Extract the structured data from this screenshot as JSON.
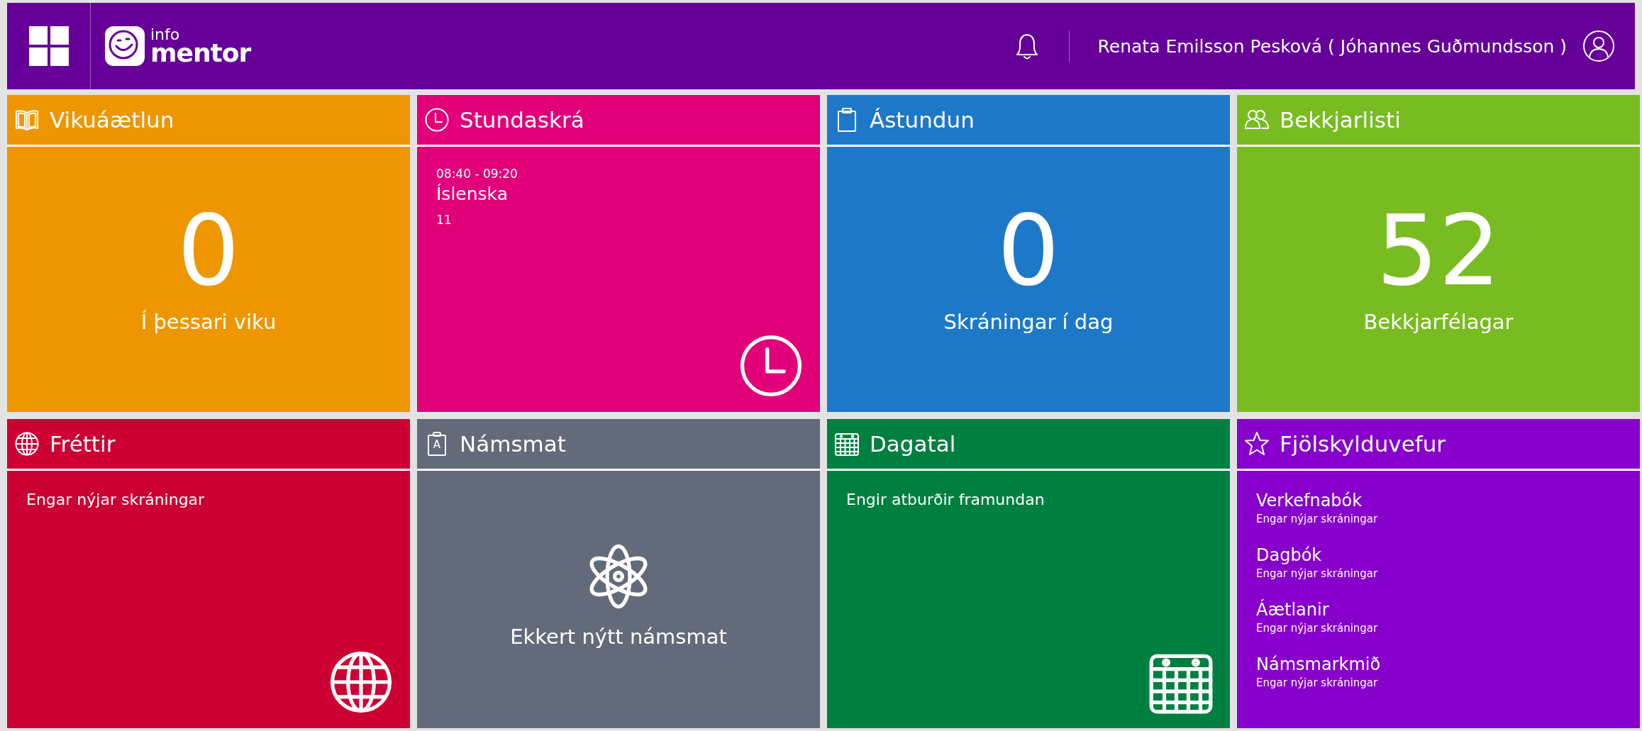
{
  "header": {
    "logo": {
      "small": "info",
      "large": "mentor"
    },
    "user": "Renata Emilsson Pesková ( Jóhannes Guðmundsson )"
  },
  "tiles": [
    {
      "kind": "week-plan",
      "color": "#ee9600",
      "title": "Vikuáætlun",
      "count": "0",
      "caption": "Í þessari viku"
    },
    {
      "kind": "timetable",
      "color": "#e2007a",
      "title": "Stundaskrá",
      "lesson": {
        "time": "08:40 - 09:20",
        "subject": "Íslenska",
        "room": "11"
      }
    },
    {
      "kind": "attendance",
      "color": "#1e78c8",
      "title": "Ástundun",
      "count": "0",
      "caption": "Skráningar í dag"
    },
    {
      "kind": "class-list",
      "color": "#79bc21",
      "title": "Bekkjarlisti",
      "count": "52",
      "caption": "Bekkjarfélagar"
    },
    {
      "kind": "news",
      "color": "#cc0033",
      "title": "Fréttir",
      "message": "Engar nýjar skráningar"
    },
    {
      "kind": "assessment",
      "color": "#636a7a",
      "title": "Námsmat",
      "icon_letter": "A",
      "caption": "Ekkert nýtt námsmat"
    },
    {
      "kind": "calendar",
      "color": "#008040",
      "title": "Dagatal",
      "message": "Engir atburðir framundan"
    },
    {
      "kind": "family",
      "color": "#8800cc",
      "title": "Fjölskylduvefur",
      "items": [
        {
          "title": "Verkefnabók",
          "status": "Engar nýjar skráningar"
        },
        {
          "title": "Dagbók",
          "status": "Engar nýjar skráningar"
        },
        {
          "title": "Áætlanir",
          "status": "Engar nýjar skráningar"
        },
        {
          "title": "Námsmarkmið",
          "status": "Engar nýjar skráningar"
        }
      ]
    }
  ]
}
